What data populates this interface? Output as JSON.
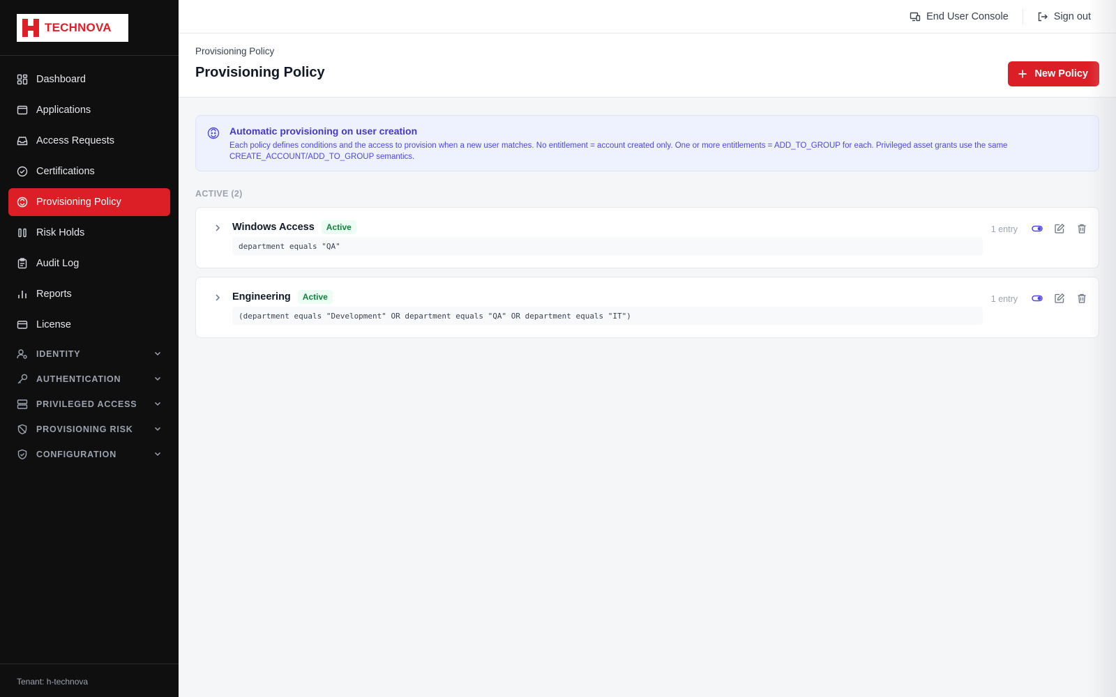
{
  "brand": {
    "name": "TECHNOVA",
    "color": "#e11d27"
  },
  "sidebar": {
    "items": [
      {
        "label": "Dashboard",
        "icon": "dashboard-icon"
      },
      {
        "label": "Applications",
        "icon": "applications-icon"
      },
      {
        "label": "Access Requests",
        "icon": "inbox-icon"
      },
      {
        "label": "Certifications",
        "icon": "check-circle-icon"
      },
      {
        "label": "Provisioning Policy",
        "icon": "provisioning-icon",
        "active": true
      },
      {
        "label": "Risk Holds",
        "icon": "pause-icon"
      },
      {
        "label": "Audit Log",
        "icon": "clipboard-icon"
      },
      {
        "label": "Reports",
        "icon": "bar-chart-icon"
      },
      {
        "label": "License",
        "icon": "card-icon"
      }
    ],
    "groups": [
      {
        "label": "IDENTITY",
        "icon": "user-gear-icon"
      },
      {
        "label": "AUTHENTICATION",
        "icon": "key-icon"
      },
      {
        "label": "PRIVILEGED ACCESS",
        "icon": "server-icon"
      },
      {
        "label": "PROVISIONING RISK",
        "icon": "shield-slash-icon"
      },
      {
        "label": "CONFIGURATION",
        "icon": "shield-check-icon"
      }
    ],
    "footer": "Tenant: h-technova"
  },
  "topbar": {
    "end_user_console": "End User Console",
    "sign_out": "Sign out"
  },
  "page": {
    "breadcrumb": "Provisioning Policy",
    "title": "Provisioning Policy",
    "new_button": "New Policy"
  },
  "info": {
    "title": "Automatic provisioning on user creation",
    "text": "Each policy defines conditions and the access to provision when a new user matches. No entitlement = account created only. One or more entitlements = ADD_TO_GROUP for each. Privileged asset grants use the same CREATE_ACCOUNT/ADD_TO_GROUP semantics."
  },
  "section": {
    "label": "ACTIVE (2)"
  },
  "policies": [
    {
      "name": "Windows Access",
      "status": "Active",
      "condition": "department equals \"QA\"",
      "entries": "1 entry"
    },
    {
      "name": "Engineering",
      "status": "Active",
      "condition": "(department equals \"Development\" OR department equals \"QA\" OR department equals \"IT\")",
      "entries": "1 entry"
    }
  ],
  "colors": {
    "accent": "#dc1f26",
    "info": "#4338ca",
    "active_badge": "#15803d",
    "toggle": "#4f46e5"
  }
}
